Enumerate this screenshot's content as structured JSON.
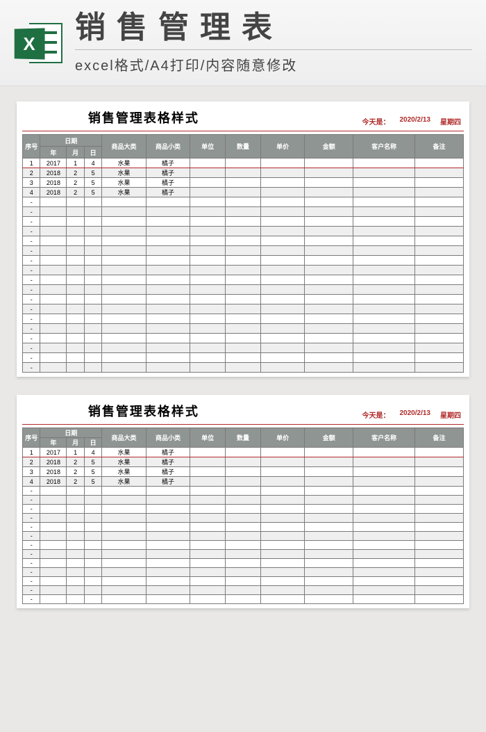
{
  "banner": {
    "title": "销售管理表",
    "subtitle": "excel格式/A4打印/内容随意修改",
    "icon_letter": "X"
  },
  "sheet": {
    "title": "销售管理表格样式",
    "meta_today_label": "今天是：",
    "meta_date": "2020/2/13",
    "meta_weekday": "星期四"
  },
  "columns": {
    "seq": "序号",
    "date_group": "日期",
    "year": "年",
    "month": "月",
    "day": "日",
    "big_cat": "商品大类",
    "small_cat": "商品小类",
    "unit": "单位",
    "qty": "数量",
    "price": "单价",
    "amount": "金额",
    "customer": "客户名称",
    "remark": "备注"
  },
  "rows": [
    {
      "seq": "1",
      "year": "2017",
      "month": "1",
      "day": "4",
      "big_cat": "水果",
      "small_cat": "橘子"
    },
    {
      "seq": "2",
      "year": "2018",
      "month": "2",
      "day": "5",
      "big_cat": "水果",
      "small_cat": "橘子"
    },
    {
      "seq": "3",
      "year": "2018",
      "month": "2",
      "day": "5",
      "big_cat": "水果",
      "small_cat": "橘子"
    },
    {
      "seq": "4",
      "year": "2018",
      "month": "2",
      "day": "5",
      "big_cat": "水果",
      "small_cat": "橘子"
    }
  ],
  "dash": "-",
  "sheet1_empty_rows": 18,
  "sheet2_empty_rows": 13
}
